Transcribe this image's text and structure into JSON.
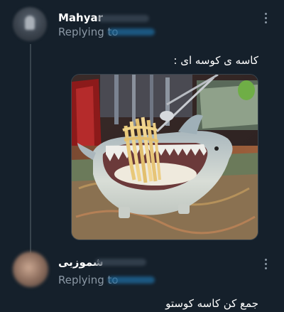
{
  "tweets": [
    {
      "author_name": "Mahyar",
      "replying_prefix": "Replying to",
      "text": "کاسه ی کوسه ای :",
      "more_icon": "more-vertical-icon"
    },
    {
      "author_name": "شموزبی",
      "replying_prefix": "Replying to",
      "text": "جمع کن کاسه کوستو",
      "more_icon": "more-vertical-icon"
    }
  ],
  "colors": {
    "background": "#15202b",
    "text_primary": "#ffffff",
    "text_secondary": "#8b98a5",
    "thread_line": "#38444d",
    "link": "#1d9bf0"
  }
}
